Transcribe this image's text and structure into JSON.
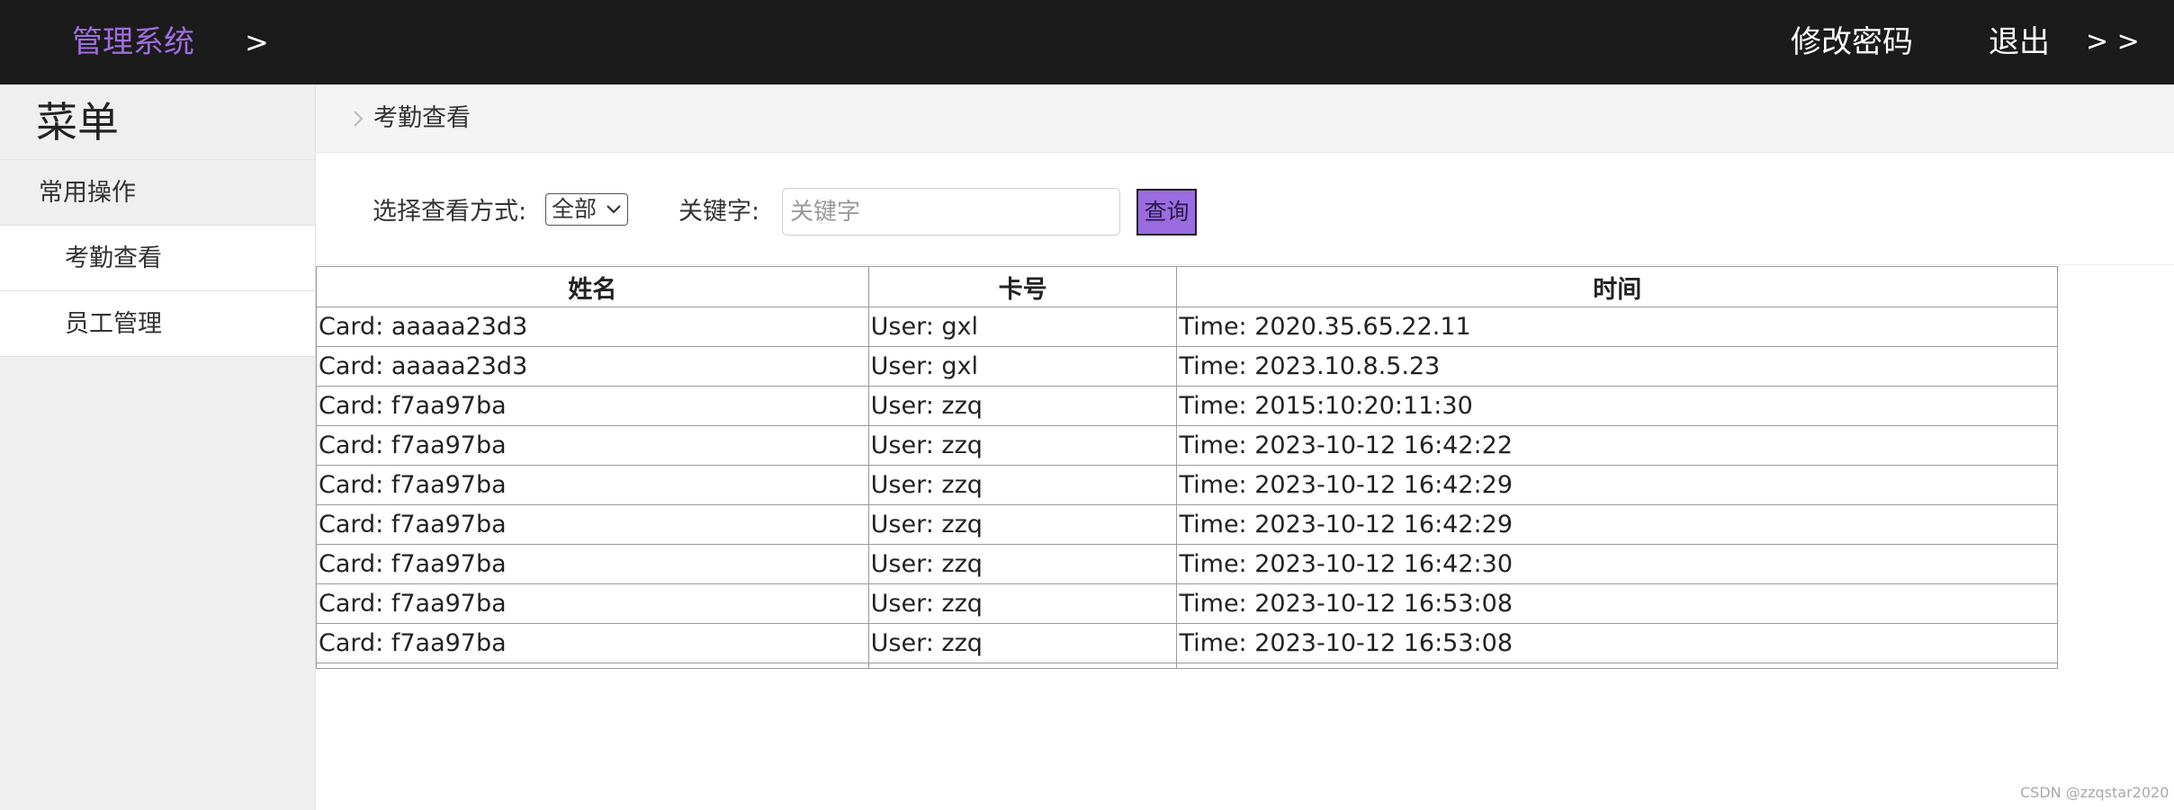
{
  "header": {
    "brand": "管理系统",
    "brand_arrow": ">",
    "change_password": "修改密码",
    "logout": "退出",
    "expand": "> >"
  },
  "sidebar": {
    "title": "菜单",
    "group": "常用操作",
    "items": [
      {
        "label": "考勤查看"
      },
      {
        "label": "员工管理"
      }
    ]
  },
  "breadcrumb": {
    "current": "考勤查看"
  },
  "filter": {
    "mode_label": "选择查看方式:",
    "mode_selected": "全部",
    "keyword_label": "关键字:",
    "keyword_placeholder": "关键字",
    "keyword_value": "",
    "query_button": "查询"
  },
  "table": {
    "columns": [
      "姓名",
      "卡号",
      "时间"
    ],
    "rows": [
      [
        "Card: aaaaa23d3",
        "User: gxl",
        "Time: 2020.35.65.22.11"
      ],
      [
        "Card: aaaaa23d3",
        "User: gxl",
        "Time: 2023.10.8.5.23"
      ],
      [
        "Card: f7aa97ba",
        "User: zzq",
        "Time: 2015:10:20:11:30"
      ],
      [
        "Card: f7aa97ba",
        "User: zzq",
        "Time: 2023-10-12 16:42:22"
      ],
      [
        "Card: f7aa97ba",
        "User: zzq",
        "Time: 2023-10-12 16:42:29"
      ],
      [
        "Card: f7aa97ba",
        "User: zzq",
        "Time: 2023-10-12 16:42:29"
      ],
      [
        "Card: f7aa97ba",
        "User: zzq",
        "Time: 2023-10-12 16:42:30"
      ],
      [
        "Card: f7aa97ba",
        "User: zzq",
        "Time: 2023-10-12 16:53:08"
      ],
      [
        "Card: f7aa97ba",
        "User: zzq",
        "Time: 2023-10-12 16:53:08"
      ]
    ]
  },
  "watermark": "CSDN @zzqstar2020",
  "colors": {
    "topbar_bg": "#1b1b1b",
    "brand": "#a06ee0",
    "query_button_bg": "#9b6be0",
    "sidebar_bg": "#efefef"
  }
}
